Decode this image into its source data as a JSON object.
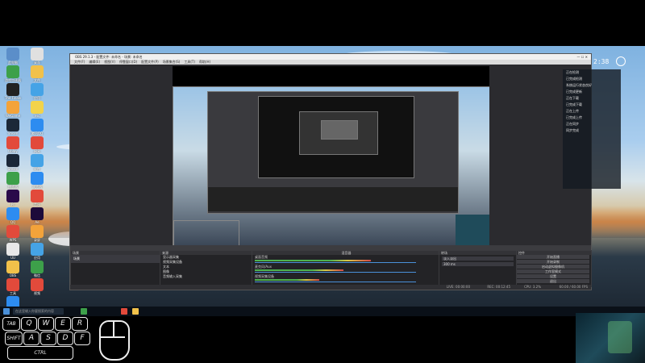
{
  "colors": {
    "obs_bg": "#2b2b2f",
    "accent": "#4a90d9",
    "meter_green": "#4fb34f"
  },
  "clock": {
    "time": "2:38"
  },
  "desktop_icons": [
    {
      "name": "computer-icon",
      "label": "此电脑",
      "color": "#5b8ec9"
    },
    {
      "name": "file-icon",
      "label": "桌面",
      "color": "#e0e0e0"
    },
    {
      "name": "app-icon",
      "label": "游戏加速器",
      "color": "#3da04a"
    },
    {
      "name": "folder-icon",
      "label": "文件",
      "color": "#f1c14a"
    },
    {
      "name": "game-icon",
      "label": "The Finals",
      "color": "#222"
    },
    {
      "name": "app-icon",
      "label": "应用",
      "color": "#45a3e6"
    },
    {
      "name": "app-icon",
      "label": "WeGame",
      "color": "#f3a33a"
    },
    {
      "name": "app-icon",
      "label": "Vsc",
      "color": "#f2d34a"
    },
    {
      "name": "app-icon",
      "label": "Steam",
      "color": "#1b2838"
    },
    {
      "name": "app-icon",
      "label": "腾讯QQ",
      "color": "#2d8cf0"
    },
    {
      "name": "app-icon",
      "label": "Uplay",
      "color": "#e24a3b"
    },
    {
      "name": "app-icon",
      "label": "网易",
      "color": "#e24a3b"
    },
    {
      "name": "app-icon",
      "label": "Steam",
      "color": "#1b2838"
    },
    {
      "name": "app-icon",
      "label": "软件",
      "color": "#45a3e6"
    },
    {
      "name": "app-icon",
      "label": "播放器",
      "color": "#3da04a"
    },
    {
      "name": "app-icon",
      "label": "浏览器",
      "color": "#2d8cf0"
    },
    {
      "name": "app-icon",
      "label": "Pr",
      "color": "#2a0a4a"
    },
    {
      "name": "app-icon",
      "label": "音乐",
      "color": "#e24a3b"
    },
    {
      "name": "app-icon",
      "label": "QQ",
      "color": "#2d8cf0"
    },
    {
      "name": "app-icon",
      "label": "Ae",
      "color": "#1d0a3a"
    },
    {
      "name": "app-icon",
      "label": "WPS",
      "color": "#e24a3b"
    },
    {
      "name": "app-icon",
      "label": "录屏",
      "color": "#f3a33a"
    },
    {
      "name": "app-icon",
      "label": "UU",
      "color": "#e8e8e8"
    },
    {
      "name": "app-icon",
      "label": "应用",
      "color": "#45a3e6"
    },
    {
      "name": "app-icon",
      "label": "OBS",
      "color": "#f1c14a"
    },
    {
      "name": "app-icon",
      "label": "微信",
      "color": "#3da04a"
    },
    {
      "name": "app-icon",
      "label": "工具",
      "color": "#e24a3b"
    },
    {
      "name": "app-icon",
      "label": "视频",
      "color": "#e24a3b"
    },
    {
      "name": "app-icon",
      "label": "网盘",
      "color": "#2d8cf0"
    }
  ],
  "obs": {
    "title": "OBS 29.1.3 - 配置文件: 未命名 - 场景: 未命名",
    "menu": [
      "文件(F)",
      "编辑(E)",
      "视图(V)",
      "停靠窗口(D)",
      "配置文件(P)",
      "场景集合(S)",
      "工具(T)",
      "帮助(H)"
    ],
    "docks": {
      "scenes": {
        "header": "场景",
        "items": [
          "场景"
        ]
      },
      "sources": {
        "header": "来源",
        "items": [
          "显示器采集",
          "视频采集设备",
          "文本",
          "图像",
          "音频输入采集"
        ]
      },
      "mixer": {
        "header": "混音器",
        "channels": [
          {
            "name": "桌面音频",
            "level": 0.72
          },
          {
            "name": "麦克风/Aux",
            "level": 0.55
          },
          {
            "name": "视频采集设备",
            "level": 0.4
          }
        ]
      },
      "transitions": {
        "header": "转场",
        "value": "淡入淡出",
        "duration": "300 ms"
      },
      "controls": {
        "header": "控件",
        "buttons": [
          "开始直播",
          "开始录制",
          "启动虚拟摄像机",
          "工作室模式",
          "设置",
          "退出"
        ]
      }
    },
    "status": {
      "live": "LIVE: 00:00:00",
      "rec": "REC: 00:12:45",
      "cpu": "CPU: 3.2%",
      "fps": "60.00 / 60.00 FPS"
    }
  },
  "notifications": {
    "lines": [
      "正在检测",
      "已完成检测",
      "系统运行状态良好",
      "",
      "",
      "",
      "已完成更新",
      "",
      "",
      "正在下载",
      "已完成下载",
      "",
      "正在上传",
      "已完成上传",
      "",
      "正在同步",
      "同步完成"
    ]
  },
  "keyboard_overlay": {
    "keys_row1": [
      "TAB",
      "Q",
      "W",
      "E",
      "R"
    ],
    "keys_row2": [
      "SHIFT",
      "A",
      "S",
      "D",
      "F"
    ],
    "keys_row3": [
      "CTRL"
    ]
  },
  "taskbar": {
    "search_placeholder": "在这里输入你要搜索的内容"
  }
}
